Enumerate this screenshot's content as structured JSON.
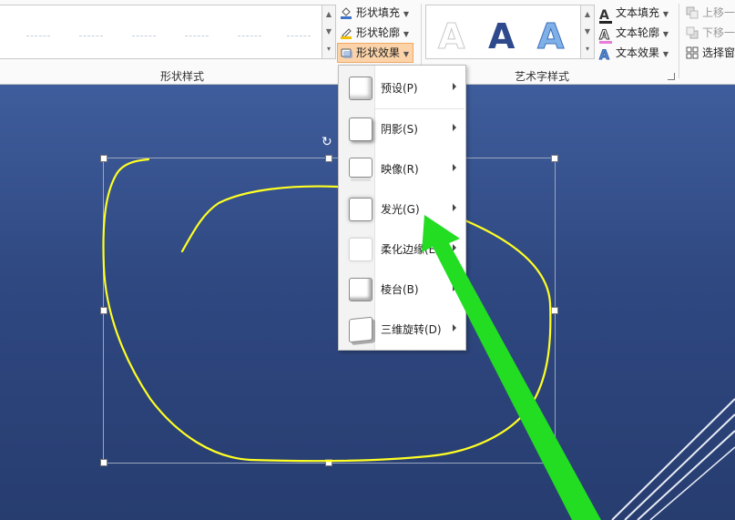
{
  "ribbon": {
    "shape_fill_label": "形状填充",
    "shape_outline_label": "形状轮廓",
    "shape_effects_label": "形状效果",
    "shape_styles_group": "形状样式",
    "wordart_styles_group": "艺术字样式",
    "text_fill_label": "文本填充",
    "text_outline_label": "文本轮廓",
    "text_effects_label": "文本效果",
    "bring_forward_label": "上移一",
    "send_backward_label": "下移一",
    "selection_pane_label": "选择窗",
    "wordart_sample_glyph": "A"
  },
  "effects_menu": {
    "items": [
      {
        "label": "预设(P)"
      },
      {
        "label": "阴影(S)"
      },
      {
        "label": "映像(R)"
      },
      {
        "label": "发光(G)"
      },
      {
        "label": "柔化边缘(E)"
      },
      {
        "label": "棱台(B)"
      },
      {
        "label": "三维旋转(D)"
      }
    ]
  },
  "colors": {
    "slide_background": "#2f4881",
    "ink_stroke": "#ffff22",
    "arrow": "#22dd22",
    "active_button": "#fcd3a8"
  }
}
